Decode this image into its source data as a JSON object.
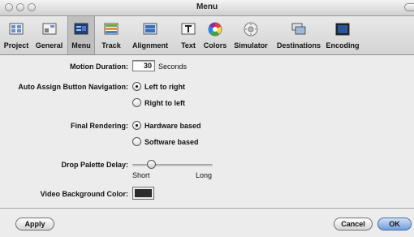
{
  "window": {
    "title": "Menu"
  },
  "toolbar": {
    "items": [
      {
        "label": "Project"
      },
      {
        "label": "General"
      },
      {
        "label": "Menu"
      },
      {
        "label": "Track"
      },
      {
        "label": "Alignment"
      },
      {
        "label": "Text"
      },
      {
        "label": "Colors"
      },
      {
        "label": "Simulator"
      },
      {
        "label": "Destinations"
      },
      {
        "label": "Encoding"
      }
    ],
    "selected": "Menu",
    "icon_names": [
      "project-icon",
      "general-icon",
      "menu-icon",
      "track-icon",
      "alignment-icon",
      "text-icon",
      "colors-icon",
      "simulator-icon",
      "destinations-icon",
      "encoding-icon"
    ]
  },
  "settings": {
    "motion_duration": {
      "label": "Motion Duration:",
      "value": "30",
      "unit": "Seconds"
    },
    "auto_assign": {
      "label": "Auto Assign Button Navigation:",
      "options": [
        "Left to right",
        "Right to left"
      ],
      "selected": "Left to right"
    },
    "final_rendering": {
      "label": "Final Rendering:",
      "options": [
        "Hardware based",
        "Software based"
      ],
      "selected": "Hardware based"
    },
    "drop_palette_delay": {
      "label": "Drop Palette Delay:",
      "min_label": "Short",
      "max_label": "Long",
      "level": 0.2
    },
    "video_bg_color": {
      "label": "Video Background Color:",
      "color": "#2d2d2d"
    }
  },
  "footer": {
    "apply": "Apply",
    "cancel": "Cancel",
    "ok": "OK"
  }
}
